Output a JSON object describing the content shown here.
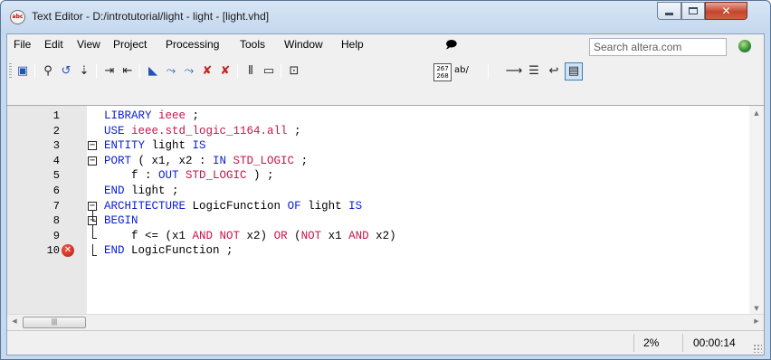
{
  "window": {
    "title": "Text Editor - D:/introtutorial/light - light - [light.vhd]",
    "app_icon_label": "abc"
  },
  "menu": {
    "items": [
      "File",
      "Edit",
      "View",
      "Project",
      "Processing",
      "Tools",
      "Window",
      "Help"
    ],
    "search_placeholder": "Search altera.com"
  },
  "toolbar": {
    "line_col_label": "267\n268",
    "wrap_label": "ab/"
  },
  "editor": {
    "lines": [
      {
        "num": "1",
        "code": [
          [
            "kw",
            "LIBRARY "
          ],
          [
            "ty",
            "ieee"
          ],
          [
            "plain",
            " ;"
          ]
        ]
      },
      {
        "num": "2",
        "code": [
          [
            "kw",
            "USE "
          ],
          [
            "ty",
            "ieee.std_logic_1164.all"
          ],
          [
            "plain",
            " ;"
          ]
        ]
      },
      {
        "num": "3",
        "code": [
          [
            "kw",
            "ENTITY "
          ],
          [
            "plain",
            "light "
          ],
          [
            "kw",
            "IS"
          ]
        ]
      },
      {
        "num": "4",
        "code": [
          [
            "kw",
            "PORT"
          ],
          [
            "plain",
            " ( x1, x2 : "
          ],
          [
            "kw",
            "IN "
          ],
          [
            "ty",
            "STD_LOGIC"
          ],
          [
            "plain",
            " ;"
          ]
        ]
      },
      {
        "num": "5",
        "code": [
          [
            "plain",
            "    f : "
          ],
          [
            "kw",
            "OUT "
          ],
          [
            "ty",
            "STD_LOGIC"
          ],
          [
            "plain",
            " ) ;"
          ]
        ]
      },
      {
        "num": "6",
        "code": [
          [
            "kw",
            "END "
          ],
          [
            "plain",
            "light ;"
          ]
        ]
      },
      {
        "num": "7",
        "code": [
          [
            "kw",
            "ARCHITECTURE "
          ],
          [
            "plain",
            "LogicFunction "
          ],
          [
            "kw",
            "OF "
          ],
          [
            "plain",
            "light "
          ],
          [
            "kw",
            "IS"
          ]
        ]
      },
      {
        "num": "8",
        "code": [
          [
            "kw",
            "BEGIN"
          ]
        ]
      },
      {
        "num": "9",
        "code": [
          [
            "plain",
            "    f <= (x1 "
          ],
          [
            "ty",
            "AND NOT "
          ],
          [
            "plain",
            "x2) "
          ],
          [
            "ty",
            "OR "
          ],
          [
            "plain",
            "("
          ],
          [
            "ty",
            "NOT "
          ],
          [
            "plain",
            "x1 "
          ],
          [
            "ty",
            "AND "
          ],
          [
            "plain",
            "x2)"
          ]
        ]
      },
      {
        "num": "10",
        "code": [
          [
            "kw",
            "END "
          ],
          [
            "plain",
            "LogicFunction ;"
          ]
        ],
        "error": true
      }
    ]
  },
  "status": {
    "percent": "2%",
    "time": "00:00:14"
  },
  "colors": {
    "keyword": "#0b1fd6",
    "type": "#c8154b"
  }
}
